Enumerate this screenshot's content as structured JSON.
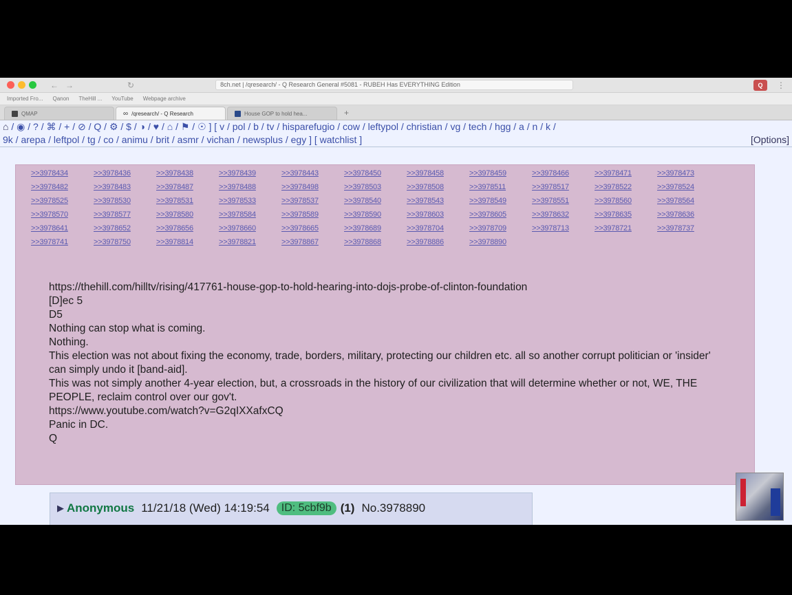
{
  "browser": {
    "address": "8ch.net | /qresearch/ - Q Research General #5081 - RUBEH Has EVERYTHING Edition",
    "bookmarks": [
      "Imported Fro...",
      "Qanon",
      "TheHill ...",
      "YouTube",
      "Webpage archive"
    ],
    "tabs": [
      {
        "label": "QMAP",
        "active": false
      },
      {
        "label": "/qresearch/ - Q Research",
        "active": true
      },
      {
        "label": "House GOP to hold hea...",
        "active": false
      }
    ],
    "new_tab": "+"
  },
  "boardnav": {
    "row1": " / ◉ / ? / ⌘ / + / ⊘ / Q / ⚙ / $ / ◑ / ♥ / ⌂ / ⚑ / ☉ ] [ v / pol / b / tv / hisparefugio / cow / leftypol / christian / vg / tech / hgg / a / n / k /",
    "row2": "9k / arepa / leftpol / tg / co / animu / brit / asmr / vichan / newsplus / egy ] [ watchlist ]",
    "options": "[Options]"
  },
  "post": {
    "replies": [
      ">>3978434",
      ">>3978436",
      ">>3978438",
      ">>3978439",
      ">>3978443",
      ">>3978450",
      ">>3978458",
      ">>3978459",
      ">>3978466",
      ">>3978471",
      ">>3978473",
      ">>3978482",
      ">>3978483",
      ">>3978487",
      ">>3978488",
      ">>3978498",
      ">>3978503",
      ">>3978508",
      ">>3978511",
      ">>3978517",
      ">>3978522",
      ">>3978524",
      ">>3978525",
      ">>3978530",
      ">>3978531",
      ">>3978533",
      ">>3978537",
      ">>3978540",
      ">>3978543",
      ">>3978549",
      ">>3978551",
      ">>3978560",
      ">>3978564",
      ">>3978570",
      ">>3978577",
      ">>3978580",
      ">>3978584",
      ">>3978589",
      ">>3978590",
      ">>3978603",
      ">>3978605",
      ">>3978632",
      ">>3978635",
      ">>3978636",
      ">>3978641",
      ">>3978652",
      ">>3978656",
      ">>3978660",
      ">>3978665",
      ">>3978689",
      ">>3978704",
      ">>3978709",
      ">>3978713",
      ">>3978721",
      ">>3978737",
      ">>3978741",
      ">>3978750",
      ">>3978814",
      ">>3978821",
      ">>3978867",
      ">>3978868",
      ">>3978886",
      ">>3978890"
    ],
    "lines": [
      "https://thehill.com/hilltv/rising/417761-house-gop-to-hold-hearing-into-dojs-probe-of-clinton-foundation",
      "[D]ec 5",
      "D5",
      "Nothing can stop what is coming.",
      "Nothing.",
      "This election was not about fixing the economy, trade, borders, military, protecting our children etc. all so another corrupt politician or 'insider' can simply undo it [band-aid].",
      "This was not simply another 4-year election, but, a crossroads in the history of our civilization that will determine whether or not, WE, THE PEOPLE, reclaim control over our gov't.",
      "https://www.youtube.com/watch?v=G2qIXXafxCQ",
      "Panic in DC.",
      "Q"
    ]
  },
  "reply": {
    "arrow": "▶",
    "name": "Anonymous",
    "date": "11/21/18 (Wed) 14:19:54",
    "id": "ID: 5cbf9b",
    "count": "(1)",
    "number": "No.3978890"
  }
}
